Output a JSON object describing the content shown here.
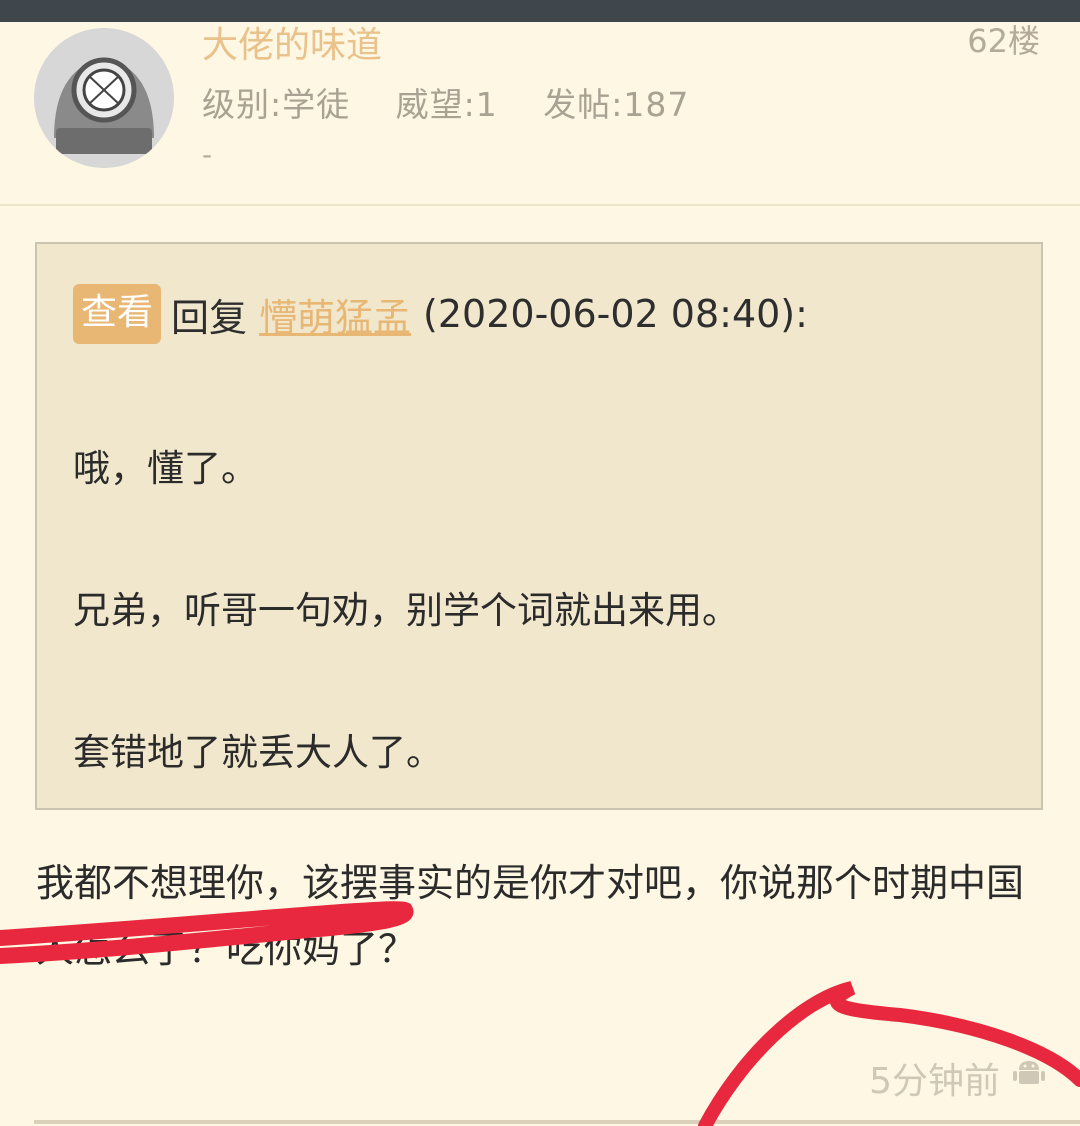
{
  "post": {
    "username": "大佬的味道",
    "floor": "62楼",
    "level": "级别:学徒",
    "prestige": "威望:1",
    "posts": "发帖:187",
    "signature": "-",
    "time": "5分钟前",
    "body": "我都不想理你，该摆事实的是你才对吧，你说那个时期中国人怎么了？吃你妈了？"
  },
  "quote": {
    "view_label": "查看",
    "reply_label": "回复",
    "reply_to": "懵萌猛孟",
    "timestamp": "(2020-06-02 08:40):",
    "paragraphs": [
      "哦，懂了。",
      "兄弟，听哥一句劝，别学个词就出来用。",
      "套错地了就丢大人了。"
    ]
  },
  "icons": {
    "avatar": "diving-helmet-avatar",
    "platform": "android-icon"
  },
  "colors": {
    "background": "#fdf7e3",
    "accent": "#e9b774",
    "scribble": "#e8283e"
  }
}
